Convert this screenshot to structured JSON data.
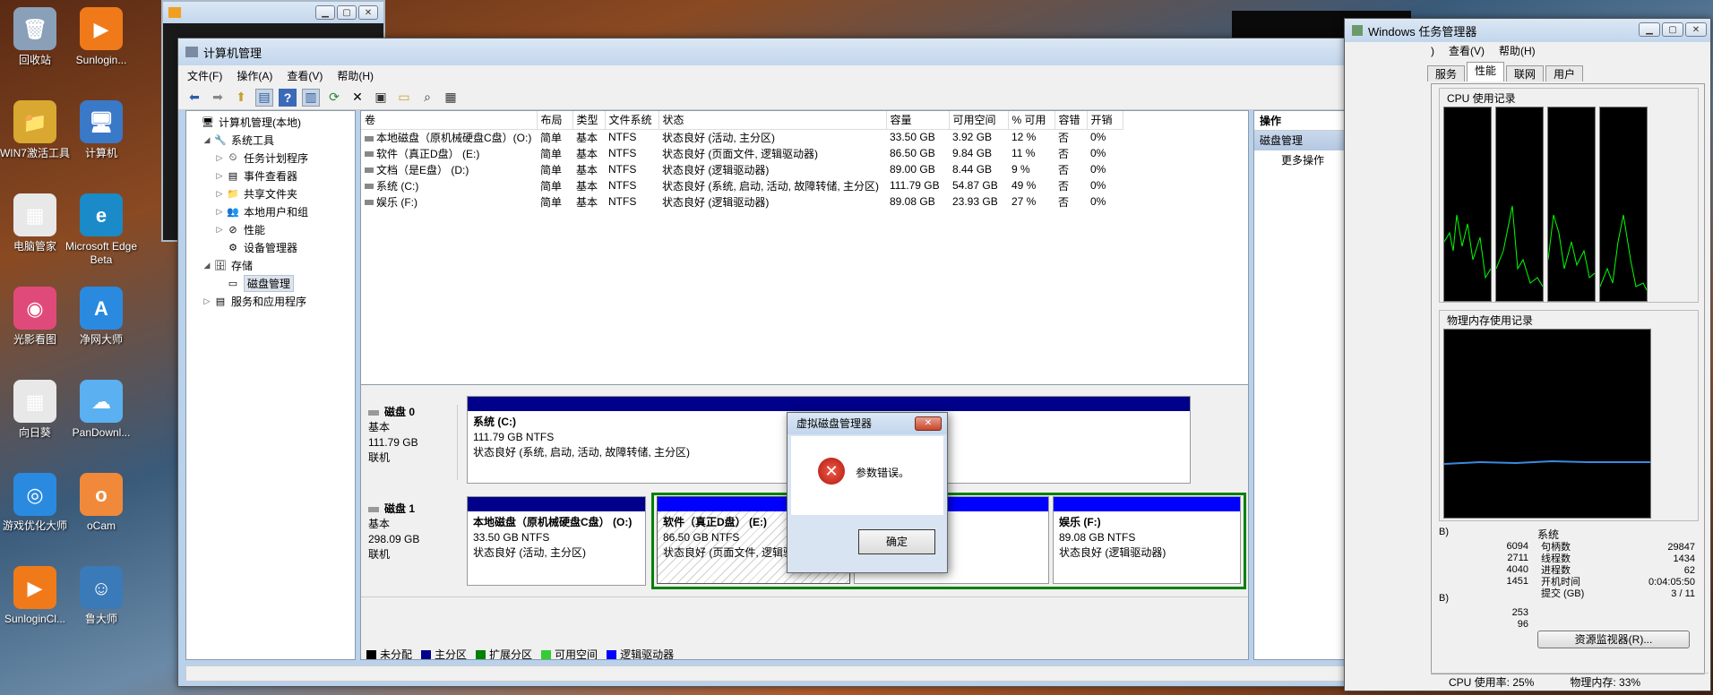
{
  "desktop": {
    "icons": [
      {
        "label": "回收站",
        "color": "#8aa0b8",
        "glyph": "🗑"
      },
      {
        "label": "Sunlogin...",
        "color": "#f07a1a",
        "glyph": "▶"
      },
      {
        "label": "WIN7激活工具",
        "color": "#d9a830",
        "glyph": "📁"
      },
      {
        "label": "计算机",
        "color": "#3a78c8",
        "glyph": "🖥"
      },
      {
        "label": "电脑管家",
        "color": "#e8e8e8",
        "glyph": "▦"
      },
      {
        "label": "Microsoft Edge Beta",
        "color": "#1a8ac8",
        "glyph": "e"
      },
      {
        "label": "光影看图",
        "color": "#e04a7a",
        "glyph": "◉"
      },
      {
        "label": "净网大师",
        "color": "#2a8ae0",
        "glyph": "A"
      },
      {
        "label": "向日葵",
        "color": "#e8e8e8",
        "glyph": "▦"
      },
      {
        "label": "PanDownl...",
        "color": "#5ab0f0",
        "glyph": "☁"
      },
      {
        "label": "游戏优化大师",
        "color": "#2a8ae0",
        "glyph": "◎"
      },
      {
        "label": "oCam",
        "color": "#f08a3a",
        "glyph": "o"
      },
      {
        "label": "SunloginCl...",
        "color": "#f07a1a",
        "glyph": "▶"
      },
      {
        "label": "鲁大师",
        "color": "#3a7ab8",
        "glyph": "☺"
      }
    ]
  },
  "mmc": {
    "title": "计算机管理",
    "menus": [
      "文件(F)",
      "操作(A)",
      "查看(V)",
      "帮助(H)"
    ],
    "tree": [
      {
        "label": "计算机管理(本地)",
        "level": 0,
        "expander": "",
        "icon": "🖥"
      },
      {
        "label": "系统工具",
        "level": 1,
        "expander": "◢",
        "icon": "🔧"
      },
      {
        "label": "任务计划程序",
        "level": 2,
        "expander": "▷",
        "icon": "⏲"
      },
      {
        "label": "事件查看器",
        "level": 2,
        "expander": "▷",
        "icon": "▤"
      },
      {
        "label": "共享文件夹",
        "level": 2,
        "expander": "▷",
        "icon": "📁"
      },
      {
        "label": "本地用户和组",
        "level": 2,
        "expander": "▷",
        "icon": "👥"
      },
      {
        "label": "性能",
        "level": 2,
        "expander": "▷",
        "icon": "⊘"
      },
      {
        "label": "设备管理器",
        "level": 2,
        "expander": "",
        "icon": "⚙"
      },
      {
        "label": "存储",
        "level": 1,
        "expander": "◢",
        "icon": "🗄"
      },
      {
        "label": "磁盘管理",
        "level": 2,
        "expander": "",
        "icon": "▭",
        "selected": true
      },
      {
        "label": "服务和应用程序",
        "level": 1,
        "expander": "▷",
        "icon": "▤"
      }
    ],
    "columns": [
      "卷",
      "布局",
      "类型",
      "文件系统",
      "状态",
      "容量",
      "可用空间",
      "% 可用",
      "容错",
      "开销"
    ],
    "volumes": [
      [
        "本地磁盘（原机械硬盘C盘）(O:)",
        "简单",
        "基本",
        "NTFS",
        "状态良好 (活动, 主分区)",
        "33.50 GB",
        "3.92 GB",
        "12 %",
        "否",
        "0%"
      ],
      [
        "软件（真正D盘） (E:)",
        "简单",
        "基本",
        "NTFS",
        "状态良好 (页面文件, 逻辑驱动器)",
        "86.50 GB",
        "9.84 GB",
        "11 %",
        "否",
        "0%"
      ],
      [
        "文档（是E盘） (D:)",
        "简单",
        "基本",
        "NTFS",
        "状态良好 (逻辑驱动器)",
        "89.00 GB",
        "8.44 GB",
        "9 %",
        "否",
        "0%"
      ],
      [
        "系统 (C:)",
        "简单",
        "基本",
        "NTFS",
        "状态良好 (系统, 启动, 活动, 故障转储, 主分区)",
        "111.79 GB",
        "54.87 GB",
        "49 %",
        "否",
        "0%"
      ],
      [
        "娱乐 (F:)",
        "简单",
        "基本",
        "NTFS",
        "状态良好 (逻辑驱动器)",
        "89.08 GB",
        "23.93 GB",
        "27 %",
        "否",
        "0%"
      ]
    ],
    "disk0": {
      "name": "磁盘 0",
      "type": "基本",
      "size": "111.79 GB",
      "status": "联机",
      "partition": {
        "name": "系统 (C:)",
        "size": "111.79 GB NTFS",
        "status": "状态良好 (系统, 启动, 活动, 故障转储, 主分区)"
      }
    },
    "disk1": {
      "name": "磁盘 1",
      "type": "基本",
      "size": "298.09 GB",
      "status": "联机",
      "partitions": [
        {
          "name": "本地磁盘（原机械硬盘C盘） (O:)",
          "size": "33.50 GB NTFS",
          "status": "状态良好 (活动, 主分区)"
        },
        {
          "name": "软件（真正D盘） (E:)",
          "size": "86.50 GB NTFS",
          "status": "状态良好 (页面文件, 逻辑驱动器)"
        },
        {
          "name": ")",
          "size": "",
          "status": ")"
        },
        {
          "name": "娱乐 (F:)",
          "size": "89.08 GB NTFS",
          "status": "状态良好 (逻辑驱动器)"
        }
      ]
    },
    "legend": [
      {
        "label": "未分配",
        "color": "#000000"
      },
      {
        "label": "主分区",
        "color": "#00008b"
      },
      {
        "label": "扩展分区",
        "color": "#008000"
      },
      {
        "label": "可用空间",
        "color": "#32cd32"
      },
      {
        "label": "逻辑驱动器",
        "color": "#0000ff"
      }
    ],
    "actions": {
      "title": "操作",
      "section": "磁盘管理",
      "more": "更多操作"
    }
  },
  "dialog": {
    "title": "虚拟磁盘管理器",
    "message": "参数错误。",
    "ok": "确定"
  },
  "taskmgr": {
    "title": "Windows 任务管理器",
    "menus": [
      ")",
      "查看(V)",
      "帮助(H)"
    ],
    "tabs": [
      "服务",
      "性能",
      "联网",
      "用户"
    ],
    "active_tab": "性能",
    "cpu_history_label": "CPU 使用记录",
    "mem_history_label": "物理内存使用记录",
    "left_values": [
      "6094",
      "2711",
      "4040",
      "1451"
    ],
    "left_values2": [
      "253",
      "96"
    ],
    "left_fragment1": "B)",
    "left_fragment2": "B)",
    "system_title": "系统",
    "system": [
      {
        "label": "句柄数",
        "value": "29847"
      },
      {
        "label": "线程数",
        "value": "1434"
      },
      {
        "label": "进程数",
        "value": "62"
      },
      {
        "label": "开机时间",
        "value": "0:04:05:50"
      },
      {
        "label": "提交 (GB)",
        "value": "3 / 11"
      }
    ],
    "resource_monitor": "资源监视器(R)...",
    "cpu_usage": "CPU 使用率: 25%",
    "mem_usage": "物理内存: 33%"
  }
}
